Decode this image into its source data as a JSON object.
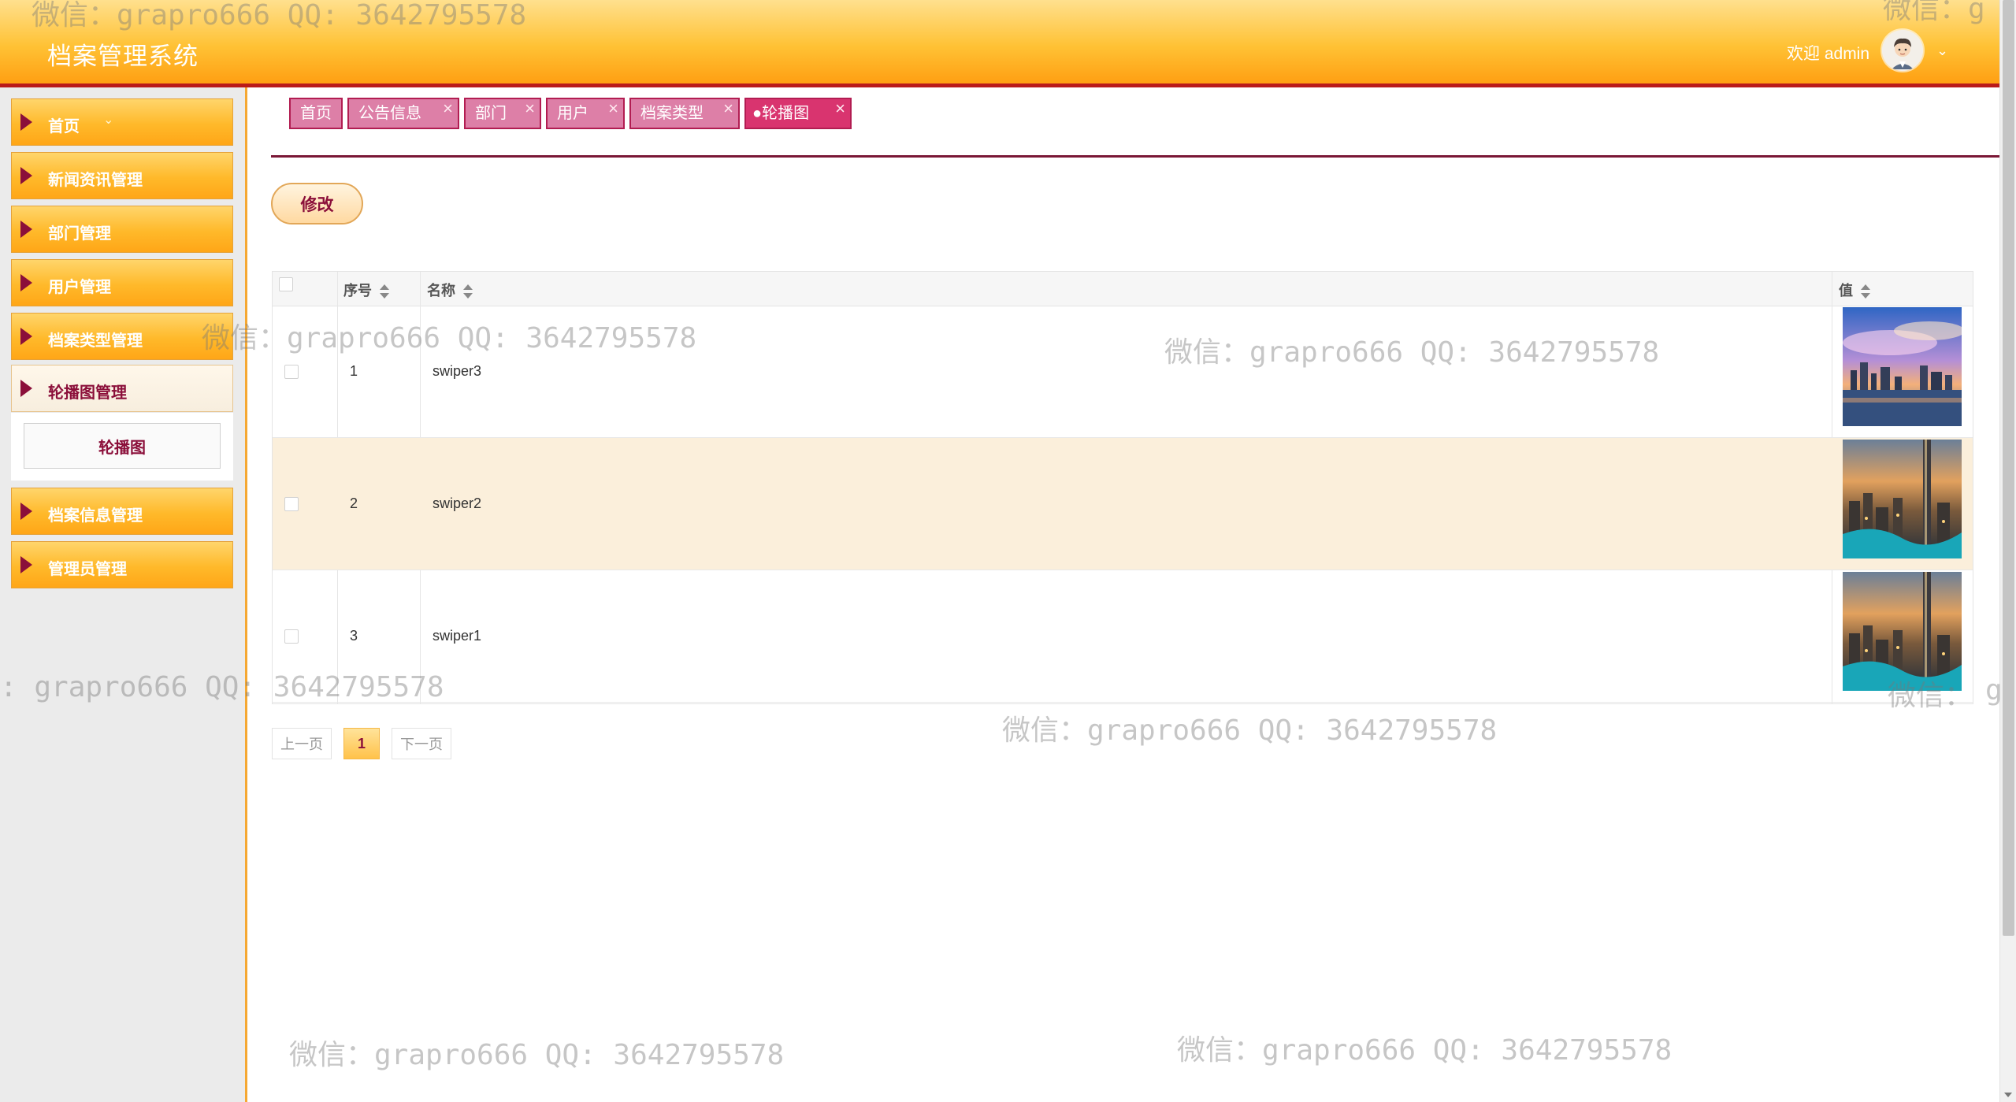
{
  "app": {
    "title": "档案管理系统"
  },
  "header": {
    "welcome": "欢迎 admin"
  },
  "sidebar": {
    "items": [
      {
        "label": "首页"
      },
      {
        "label": "新闻资讯管理"
      },
      {
        "label": "部门管理"
      },
      {
        "label": "用户管理"
      },
      {
        "label": "档案类型管理"
      },
      {
        "label": "轮播图管理"
      },
      {
        "label": "档案信息管理"
      },
      {
        "label": "管理员管理"
      }
    ],
    "submenu": {
      "label": "轮播图"
    }
  },
  "tabs": [
    {
      "label": "首页"
    },
    {
      "label": "公告信息"
    },
    {
      "label": "部门"
    },
    {
      "label": "用户"
    },
    {
      "label": "档案类型"
    },
    {
      "label": "●轮播图"
    }
  ],
  "toolbar": {
    "edit_label": "修改"
  },
  "table": {
    "columns": {
      "index": "序号",
      "name": "名称",
      "value": "值"
    },
    "rows": [
      {
        "index": "1",
        "name": "swiper3",
        "image": "city-skyline-sunset-thumbnail"
      },
      {
        "index": "2",
        "name": "swiper2",
        "image": "city-tower-night-thumbnail"
      },
      {
        "index": "3",
        "name": "swiper1",
        "image": "city-tower-night-thumbnail"
      }
    ]
  },
  "pagination": {
    "prev": "上一页",
    "current": "1",
    "next": "下一页"
  },
  "watermark": {
    "text": "微信：grapro666 QQ: 3642795578"
  },
  "colors": {
    "header_orange": "#ffb12a",
    "accent_dark_red": "#8b0f3a",
    "tab_pink": "#dd7fa7",
    "row_stripe": "#fbefdb"
  }
}
